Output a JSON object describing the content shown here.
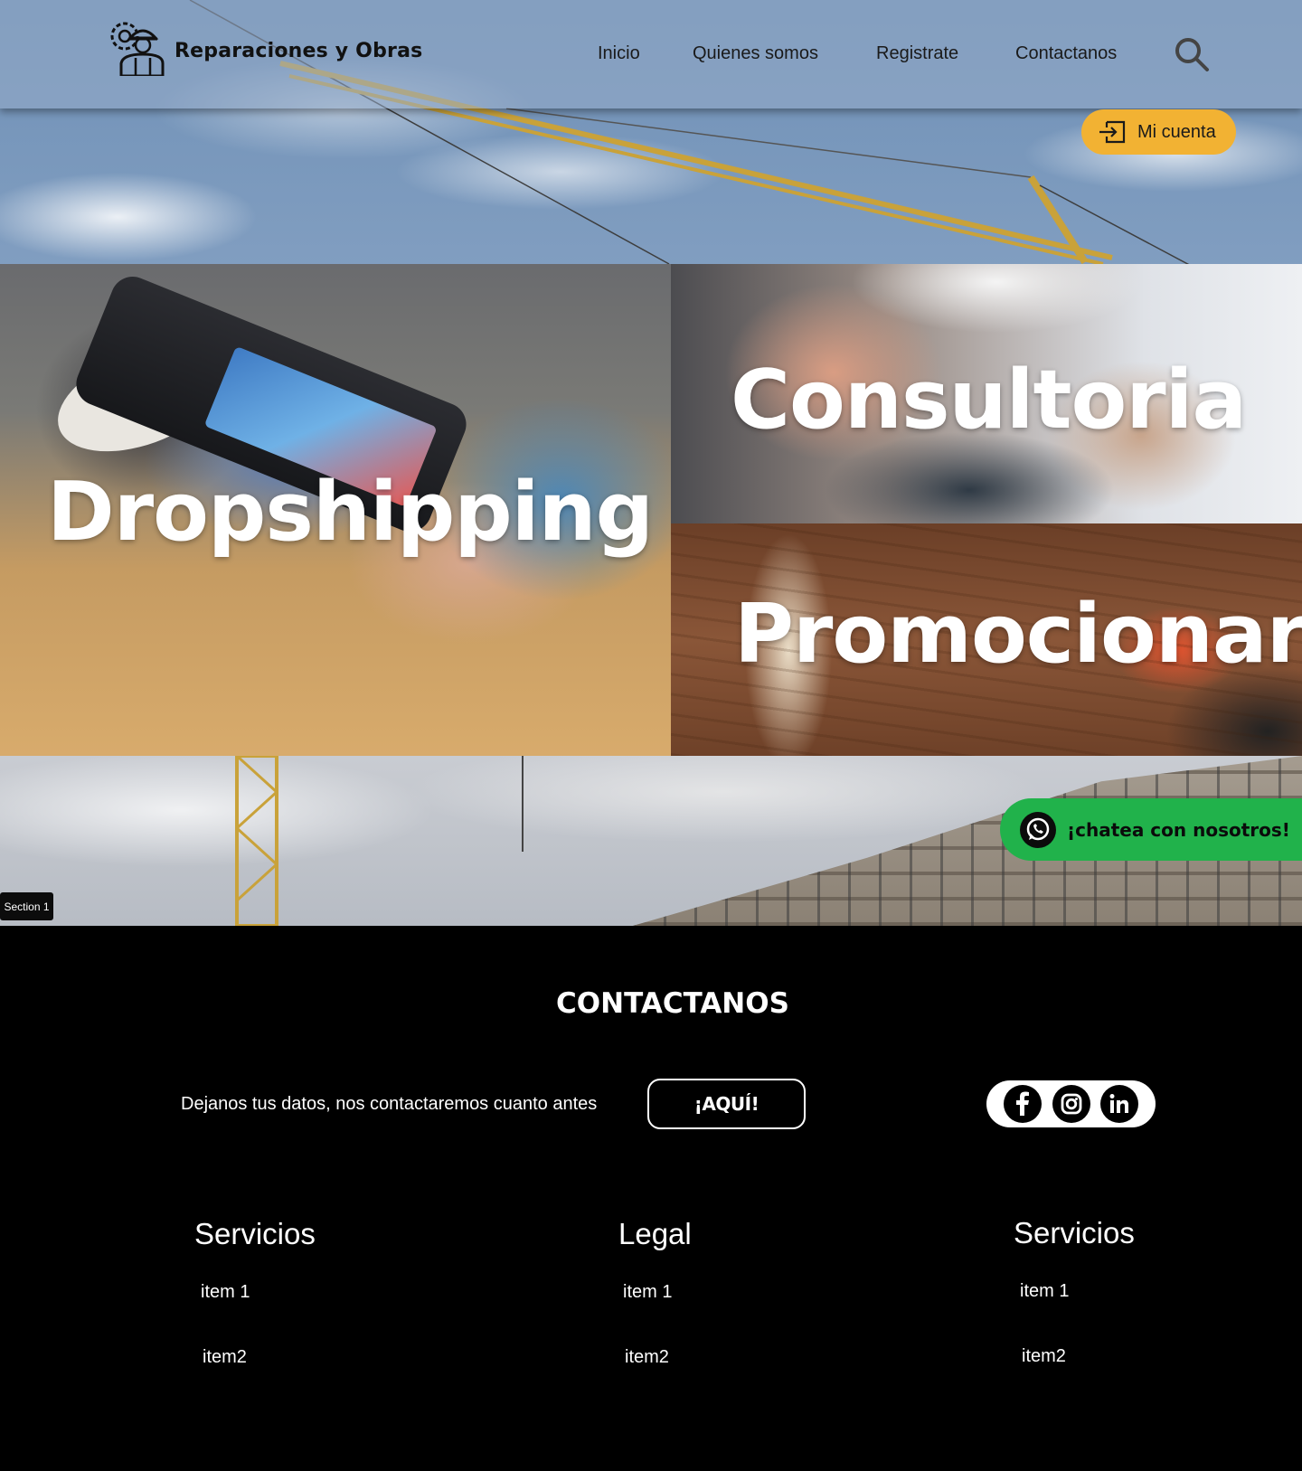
{
  "header": {
    "brand": "Reparaciones y Obras",
    "nav": [
      "Inicio",
      "Quienes somos",
      "Registrate",
      "Contactanos"
    ],
    "account_label": "Mi cuenta"
  },
  "tiles": {
    "dropshipping": "Dropshipping",
    "consultoria": "Consultoria",
    "promocionar": "Promocionar"
  },
  "chat": {
    "label": "¡chatea con nosotros!"
  },
  "section_tag": "Section 1",
  "footer": {
    "title": "CONTACTANOS",
    "contact_text": "Dejanos tus datos, nos contactaremos cuanto antes",
    "cta_label": "¡AQUÍ!",
    "social": [
      "facebook-icon",
      "instagram-icon",
      "linkedin-icon"
    ],
    "columns": [
      {
        "title": "Servicios",
        "items": [
          "item 1",
          "item2"
        ]
      },
      {
        "title": "Legal",
        "items": [
          "item 1",
          "item2"
        ]
      },
      {
        "title": "Servicios",
        "items": [
          "item 1",
          "item2"
        ]
      }
    ]
  },
  "colors": {
    "accent_yellow": "#f2b233",
    "whatsapp_green": "#21b24b",
    "footer_bg": "#000000"
  }
}
